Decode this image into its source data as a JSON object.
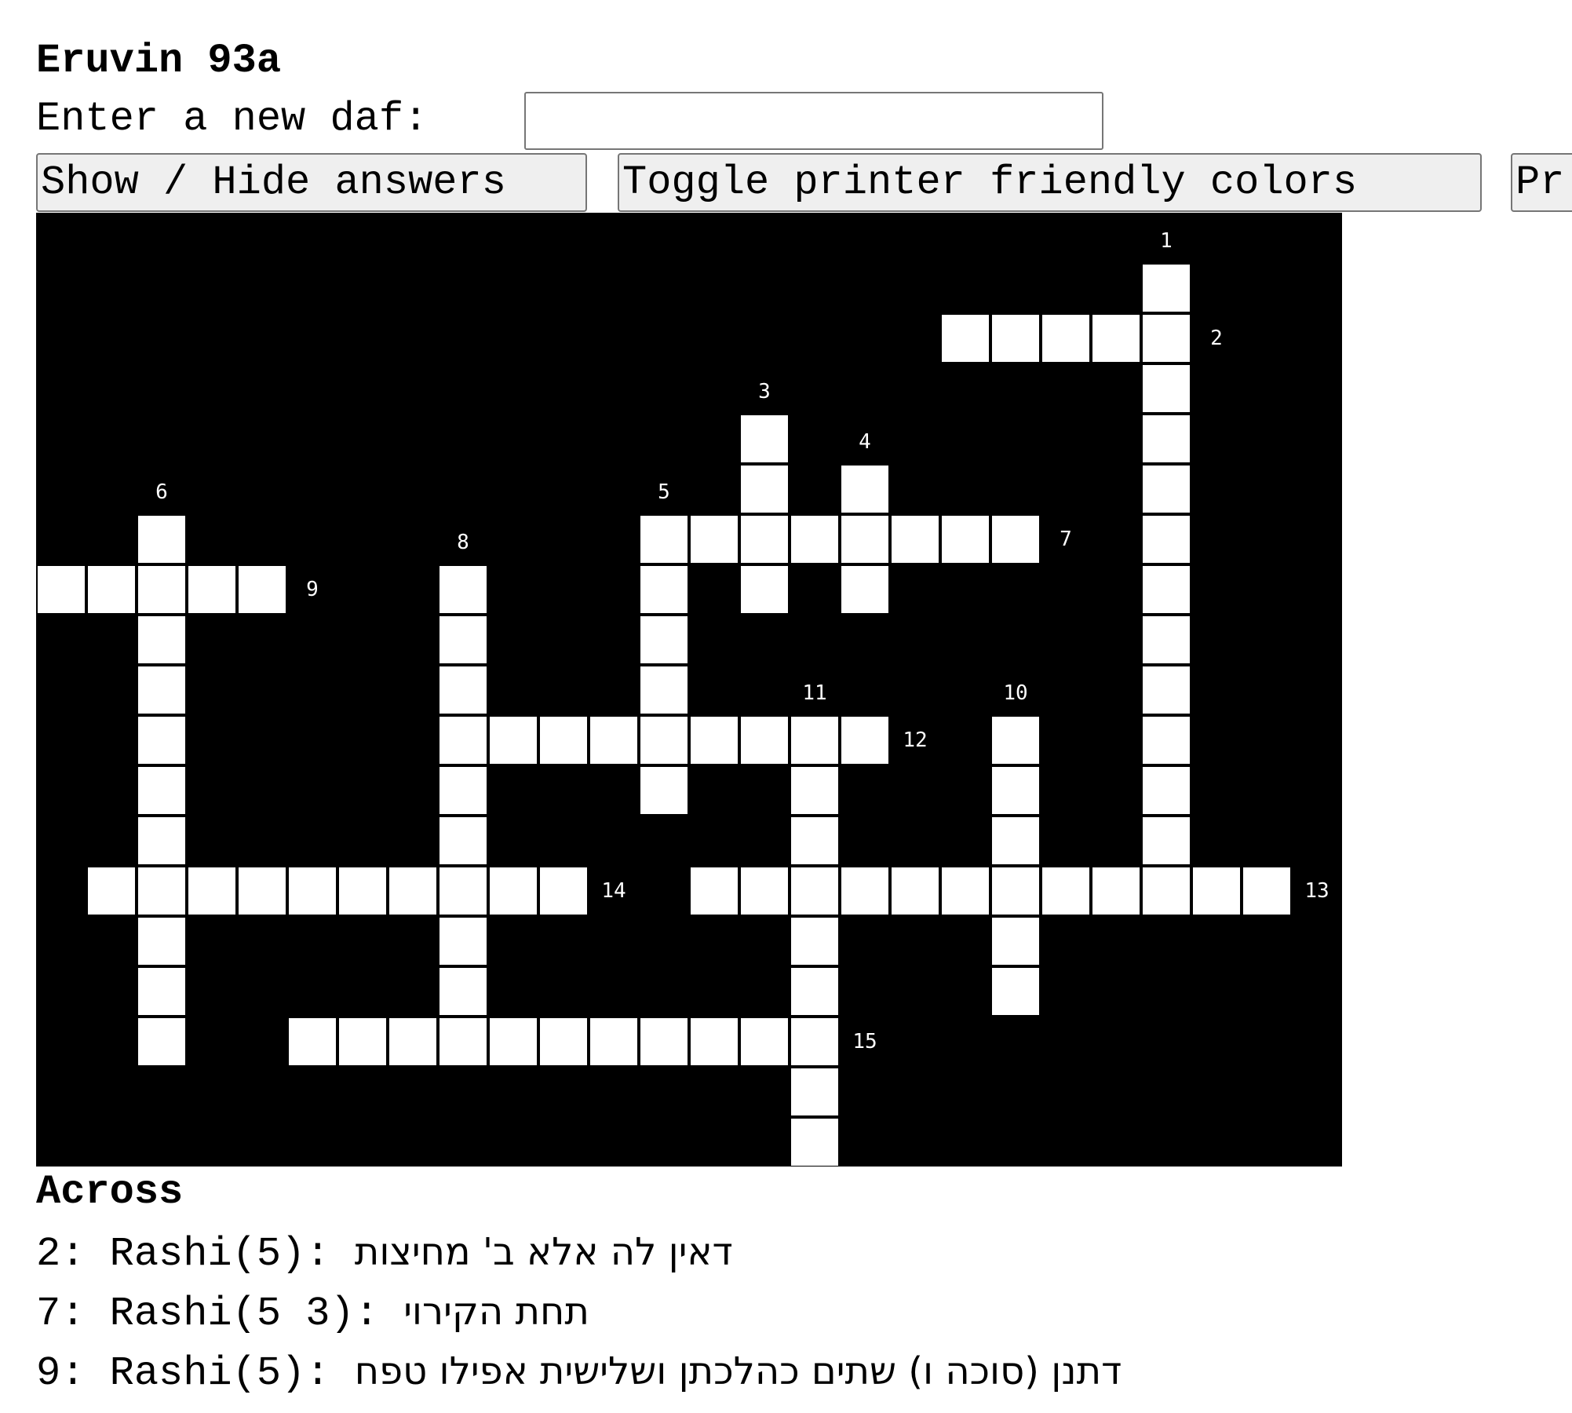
{
  "page": {
    "title": "Eruvin 93a",
    "daf_label": "Enter a new daf:",
    "daf_input_value": ""
  },
  "toolbar": {
    "answers_label": "Show / Hide answers",
    "colors_label": "Toggle printer friendly colors",
    "print_label": "Pr"
  },
  "crossword": {
    "colors": {
      "background": "#000000",
      "cell": "#ffffff",
      "number": "#ffffff"
    },
    "across": [
      {
        "n": 2,
        "row": 2,
        "col": 18,
        "len": 5,
        "num_side": "right"
      },
      {
        "n": 7,
        "row": 6,
        "col": 12,
        "len": 8,
        "num_side": "right"
      },
      {
        "n": 9,
        "row": 7,
        "col": 0,
        "len": 5,
        "num_side": "right"
      },
      {
        "n": 12,
        "row": 10,
        "col": 8,
        "len": 9,
        "num_side": "right"
      },
      {
        "n": 13,
        "row": 13,
        "col": 13,
        "len": 12,
        "num_side": "right"
      },
      {
        "n": 14,
        "row": 13,
        "col": 1,
        "len": 10,
        "num_side": "right"
      },
      {
        "n": 15,
        "row": 16,
        "col": 5,
        "len": 11,
        "num_side": "right"
      }
    ],
    "down": [
      {
        "n": 1,
        "row": 1,
        "col": 22,
        "len": 12,
        "num_side": "top"
      },
      {
        "n": 3,
        "row": 4,
        "col": 14,
        "len": 4,
        "num_side": "top"
      },
      {
        "n": 4,
        "row": 5,
        "col": 16,
        "len": 3,
        "num_side": "top"
      },
      {
        "n": 5,
        "row": 6,
        "col": 12,
        "len": 6,
        "num_side": "top"
      },
      {
        "n": 6,
        "row": 6,
        "col": 2,
        "len": 11,
        "num_side": "top"
      },
      {
        "n": 8,
        "row": 7,
        "col": 8,
        "len": 9,
        "num_side": "top"
      },
      {
        "n": 10,
        "row": 10,
        "col": 19,
        "len": 6,
        "num_side": "top"
      },
      {
        "n": 11,
        "row": 10,
        "col": 15,
        "len": 9,
        "num_side": "top"
      }
    ]
  },
  "clues": {
    "across_heading": "Across",
    "across": [
      {
        "label": "2: Rashi(5):",
        "text": "דאין לה אלא ב' מחיצות"
      },
      {
        "label": "7: Rashi(5 3):",
        "text": "תחת הקירוי"
      },
      {
        "label": "9: Rashi(5):",
        "text": "דתנן (סוכה ו) שתים כהלכתן ושלישית אפילו טפח"
      }
    ]
  }
}
